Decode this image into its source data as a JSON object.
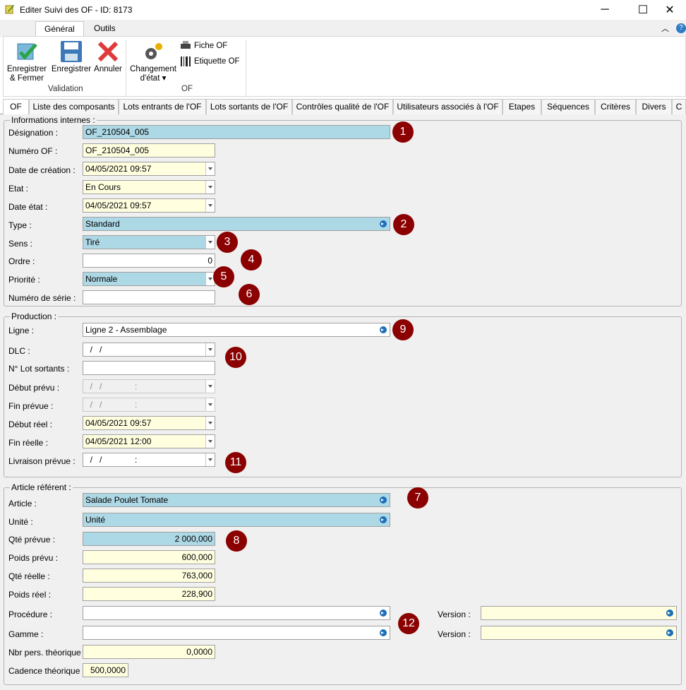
{
  "window": {
    "title": "Editer Suivi des OF - ID: 8173",
    "minimize": "─",
    "maximize": "☐",
    "close": "✕"
  },
  "ribbon": {
    "tabs": [
      "Général",
      "Outils"
    ],
    "buttons": {
      "save_close": "Enregistrer & Fermer",
      "save": "Enregistrer",
      "cancel": "Annuler",
      "change_state": "Changement d'état ▾",
      "fiche_of": "Fiche OF",
      "etiquette_of": "Etiquette OF"
    },
    "groups": {
      "validation": "Validation",
      "of": "OF"
    }
  },
  "tabs": [
    "OF",
    "Liste des composants",
    "Lots entrants de l'OF",
    "Lots sortants de l'OF",
    "Contrôles qualité de l'OF",
    "Utilisateurs associés à l'OF",
    "Etapes",
    "Séquences",
    "Critères",
    "Divers",
    "C"
  ],
  "sections": {
    "internal": "Informations internes :",
    "production": "Production :",
    "article": "Article référent :"
  },
  "labels": {
    "designation": "Désignation :",
    "numero_of": "Numéro OF :",
    "date_creation": "Date de création :",
    "etat": "Etat :",
    "date_etat": "Date état :",
    "type": "Type :",
    "sens": "Sens :",
    "ordre": "Ordre :",
    "priorite": "Priorité :",
    "numero_serie": "Numéro de série :",
    "ligne": "Ligne :",
    "dlc": "DLC :",
    "lot_sortants": "N° Lot sortants :",
    "debut_prevu": "Début prévu :",
    "fin_prevue": "Fin prévue :",
    "debut_reel": "Début réel :",
    "fin_reelle": "Fin réelle :",
    "livraison_prevue": "Livraison prévue :",
    "article": "Article :",
    "unite": "Unité :",
    "qte_prevue": "Qté prévue :",
    "poids_prevu": "Poids prévu :",
    "qte_reelle": "Qté réelle :",
    "poids_reel": "Poids réel :",
    "procedure": "Procédure :",
    "gamme": "Gamme :",
    "version": "Version :",
    "nbr_pers": "Nbr pers. théorique :",
    "cadence": "Cadence théorique :"
  },
  "values": {
    "designation": "OF_210504_005",
    "numero_of": "OF_210504_005",
    "date_creation": "04/05/2021 09:57",
    "etat": "En Cours",
    "date_etat": "04/05/2021 09:57",
    "type": "Standard",
    "sens": "Tiré",
    "ordre": "0",
    "priorite": "Normale",
    "numero_serie": "",
    "ligne": "Ligne 2 - Assemblage",
    "dlc": "  /   /",
    "lot_sortants": "",
    "debut_prevu": "  /   /              :",
    "fin_prevue": "  /   /              :",
    "debut_reel": "04/05/2021 09:57",
    "fin_reelle": "04/05/2021 12:00",
    "livraison_prevue": "  /   /              :",
    "article": "Salade Poulet Tomate",
    "unite": "Unité",
    "qte_prevue": "2 000,000",
    "poids_prevu": "600,000",
    "qte_reelle": "763,000",
    "poids_reel": "228,900",
    "procedure": "",
    "gamme": "",
    "version1": "",
    "version2": "",
    "nbr_pers": "0,0000",
    "cadence": "500,0000"
  },
  "badges": [
    "1",
    "2",
    "3",
    "4",
    "5",
    "6",
    "7",
    "8",
    "9",
    "10",
    "11",
    "12"
  ]
}
